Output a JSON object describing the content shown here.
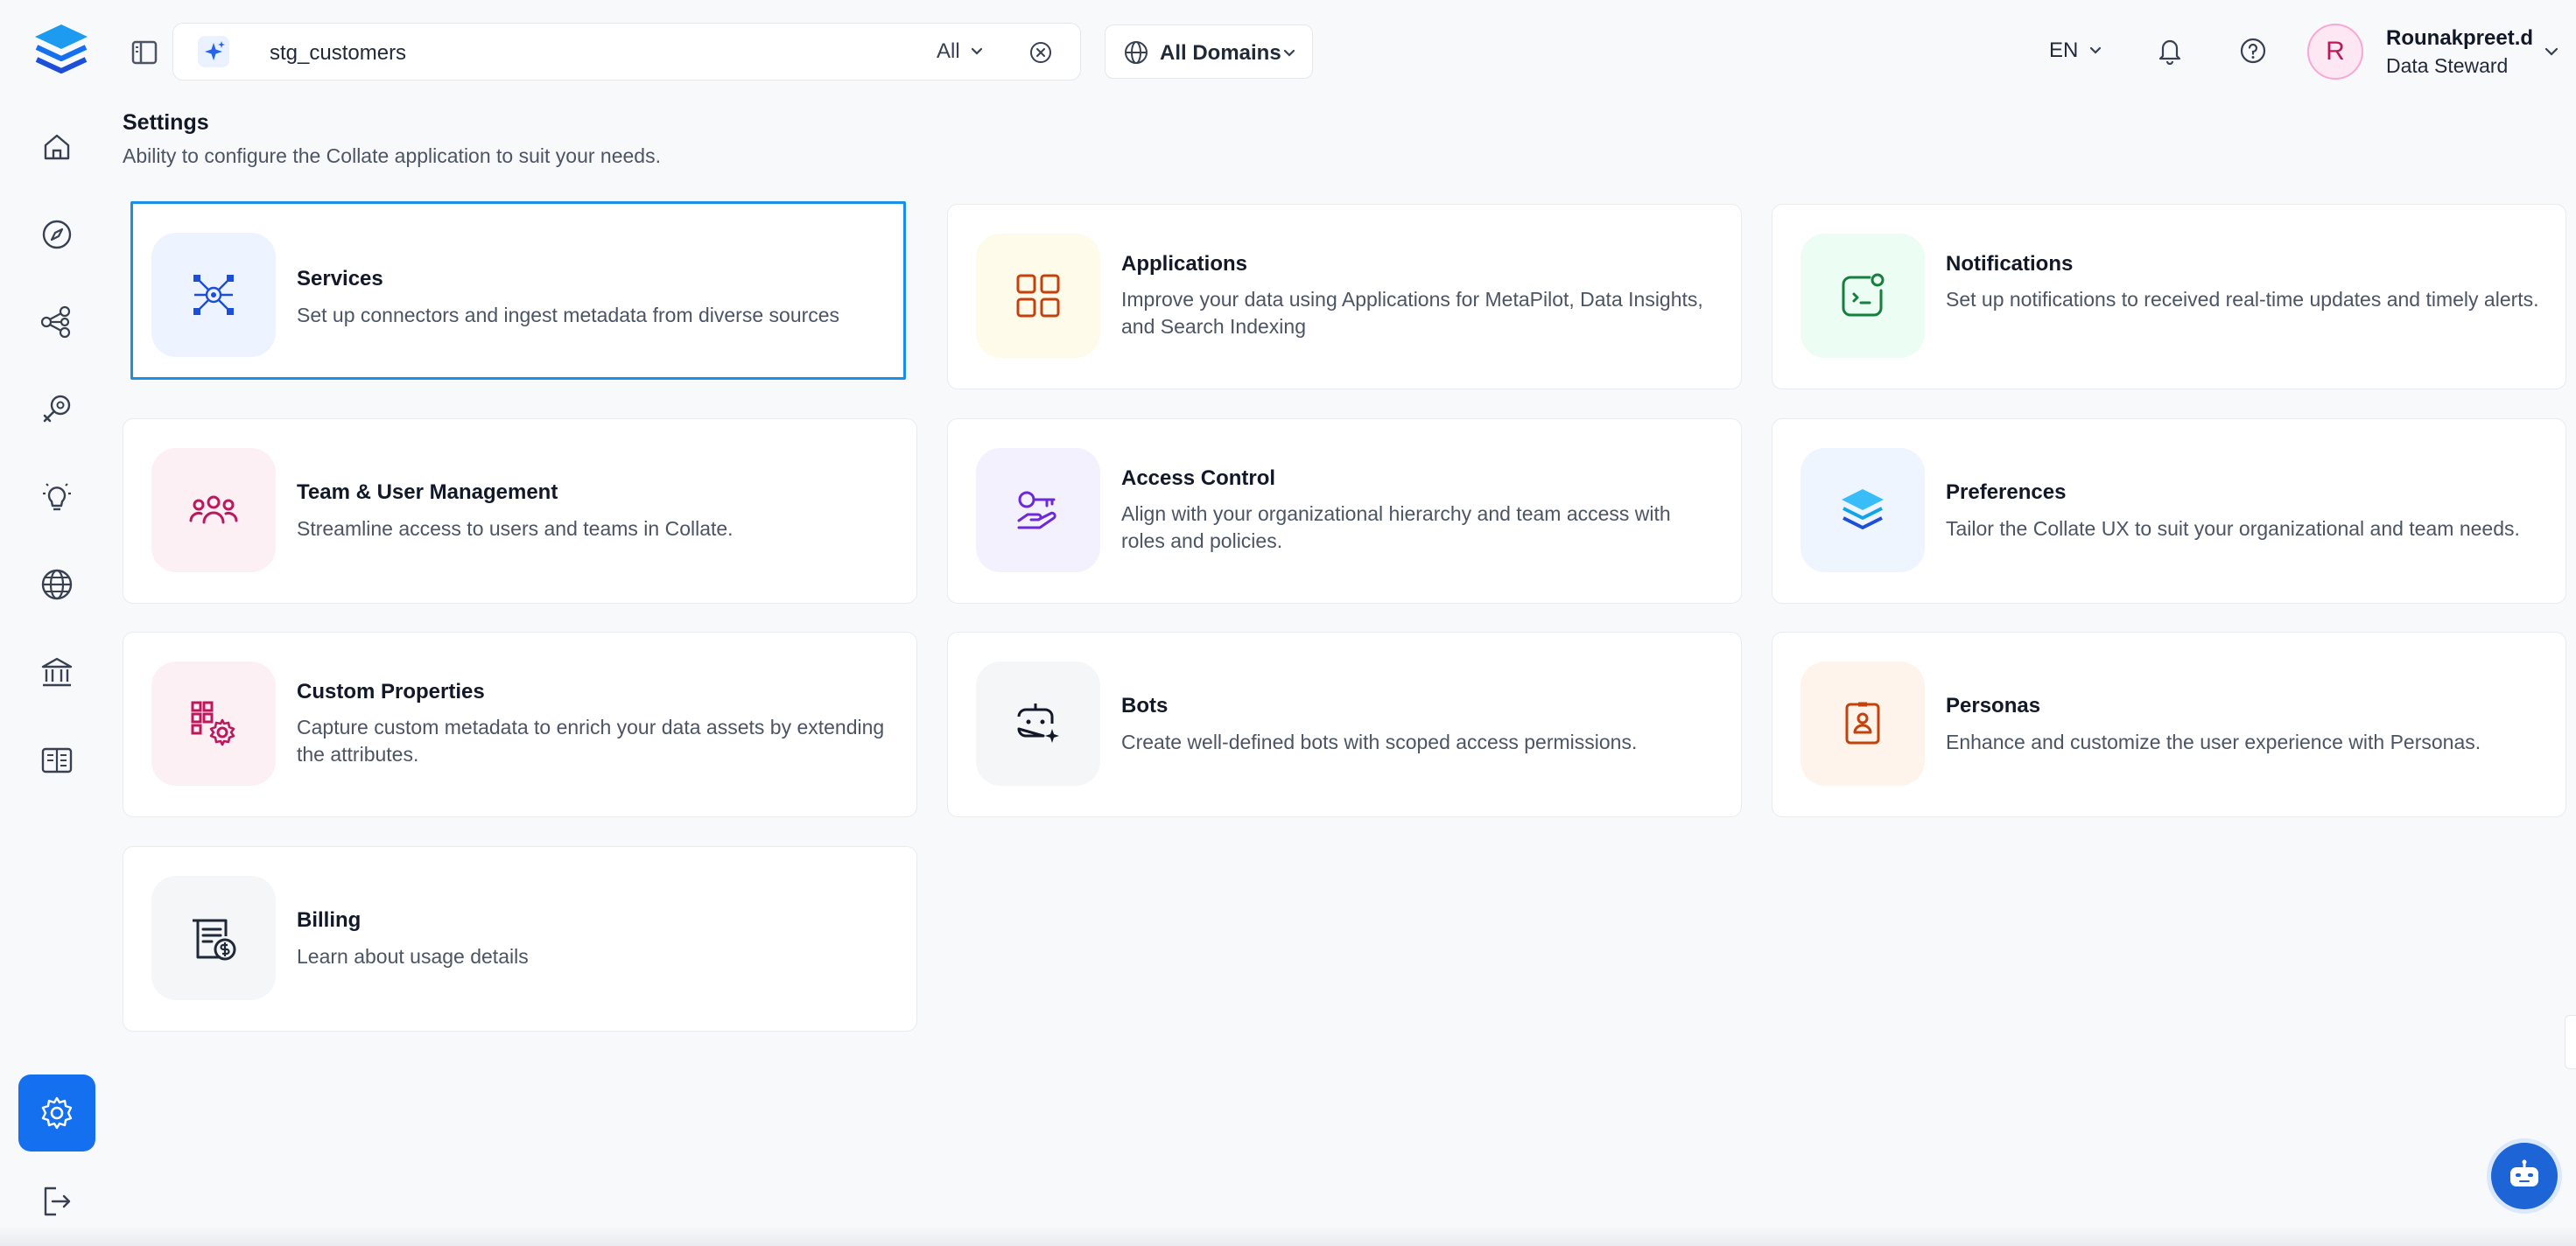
{
  "search": {
    "query": "stg_customers",
    "scope": "All"
  },
  "domains": {
    "label": "All Domains"
  },
  "header": {
    "language": "EN"
  },
  "user": {
    "initial": "R",
    "name": "Rounakpreet.d",
    "role": "Data Steward"
  },
  "nav": {
    "items": [
      "home-icon",
      "explore-icon",
      "lineage-icon",
      "observability-icon",
      "insights-icon",
      "domains-icon",
      "governance-icon",
      "glossary-icon"
    ],
    "active": "settings-icon",
    "logout": "logout-icon"
  },
  "page": {
    "title": "Settings",
    "subtitle": "Ability to configure the Collate application to suit your needs."
  },
  "colors": {
    "accent": "#1570ef",
    "selected_border": "#1a8fe8",
    "services": "#1d4ed8",
    "applications": "#c2410c",
    "notifications": "#15803d",
    "team": "#be185d",
    "access": "#6d28d9",
    "preferences": "#0ea5e9",
    "custom": "#be185d",
    "bots": "#111827",
    "personas": "#c2410c",
    "billing": "#1f2937"
  },
  "cards": [
    {
      "title": "Services",
      "description": "Set up connectors and ingest metadata from diverse sources",
      "icon": "services-icon"
    },
    {
      "title": "Applications",
      "description": "Improve your data using Applications for MetaPilot, Data Insights, and Search Indexing",
      "icon": "applications-icon"
    },
    {
      "title": "Notifications",
      "description": "Set up notifications to received real-time updates and timely alerts.",
      "icon": "notifications-icon"
    },
    {
      "title": "Team & User Management",
      "description": "Streamline access to users and teams in Collate.",
      "icon": "team-icon"
    },
    {
      "title": "Access Control",
      "description": "Align with your organizational hierarchy and team access with roles and policies.",
      "icon": "access-control-icon"
    },
    {
      "title": "Preferences",
      "description": "Tailor the Collate UX to suit your organizational and team needs.",
      "icon": "preferences-icon"
    },
    {
      "title": "Custom Properties",
      "description": "Capture custom metadata to enrich your data assets by extending the attributes.",
      "icon": "custom-properties-icon"
    },
    {
      "title": "Bots",
      "description": "Create well-defined bots with scoped access permissions.",
      "icon": "bots-icon"
    },
    {
      "title": "Personas",
      "description": "Enhance and customize the user experience with Personas.",
      "icon": "personas-icon"
    },
    {
      "title": "Billing",
      "description": "Learn about usage details",
      "icon": "billing-icon"
    }
  ]
}
